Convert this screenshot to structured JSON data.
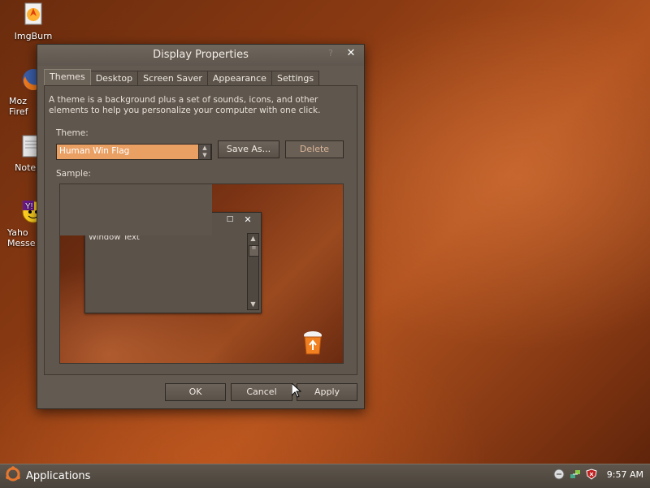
{
  "desktop": {
    "icons": [
      {
        "label": "ImgBurn"
      },
      {
        "label": "Moz\nFiref"
      },
      {
        "label": "Notepa"
      },
      {
        "label": "Yaho\nMesse"
      }
    ]
  },
  "window": {
    "title": "Display Properties",
    "help_glyph": "?",
    "close_glyph": "✕",
    "tabs": [
      {
        "label": "Themes",
        "active": true
      },
      {
        "label": "Desktop"
      },
      {
        "label": "Screen Saver"
      },
      {
        "label": "Appearance"
      },
      {
        "label": "Settings"
      }
    ],
    "themes_tab": {
      "description": "A theme is a background plus a set of sounds, icons, and other elements to help you personalize your computer with one click.",
      "theme_label": "Theme:",
      "theme_value": "Human Win Flag",
      "save_as_label": "Save As...",
      "delete_label": "Delete",
      "sample_label": "Sample:",
      "sample": {
        "window_text": "Window Text",
        "max_glyph": "□",
        "close_glyph": "✕"
      }
    },
    "buttons": {
      "ok": "OK",
      "cancel": "Cancel",
      "apply": "Apply"
    }
  },
  "taskbar": {
    "start_label": "Applications",
    "clock": "9:57 AM"
  },
  "colors": {
    "accent_orange": "#ea9f63",
    "window_bg": "#635a51",
    "taskbar_bg": "#5e564c"
  }
}
